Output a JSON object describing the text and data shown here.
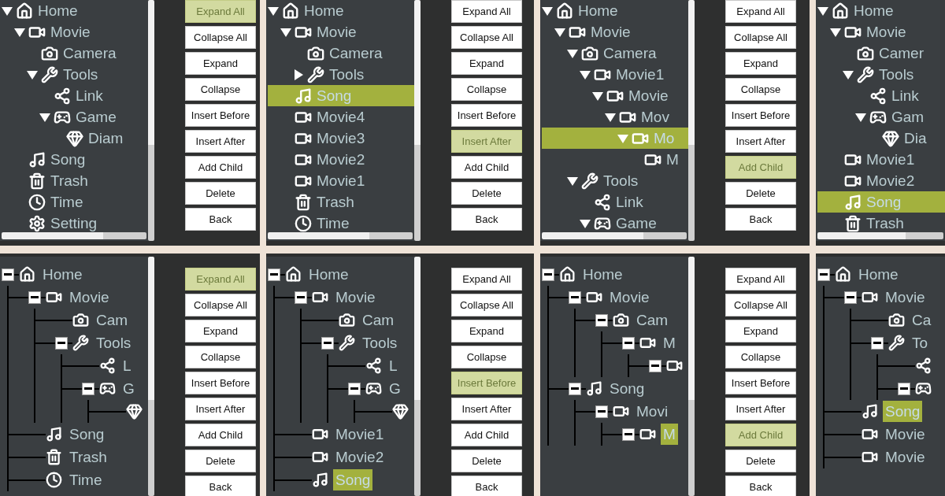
{
  "rows": [
    {
      "panels": [
        {
          "kind": "arrows",
          "tree": [
            {
              "label": "Home",
              "kind": "home",
              "expanded": true,
              "selected": false,
              "children": [
                {
                  "label": "Movie",
                  "kind": "movie",
                  "expanded": true,
                  "selected": false,
                  "children": [
                    {
                      "label": "Camera",
                      "kind": "camera",
                      "selected": false
                    },
                    {
                      "label": "Tools",
                      "kind": "tools",
                      "expanded": true,
                      "selected": false,
                      "children": [
                        {
                          "label": "Link",
                          "kind": "link",
                          "selected": false
                        },
                        {
                          "label": "Game",
                          "kind": "game",
                          "expanded": true,
                          "selected": false,
                          "children": [
                            {
                              "label": "Diam",
                              "kind": "diamond",
                              "selected": false
                            }
                          ]
                        }
                      ]
                    }
                  ]
                },
                {
                  "label": "Song",
                  "kind": "song",
                  "selected": false
                },
                {
                  "label": "Trash",
                  "kind": "trash",
                  "selected": false
                },
                {
                  "label": "Time",
                  "kind": "time",
                  "selected": false
                },
                {
                  "label": "Setting",
                  "kind": "setting",
                  "selected": false
                }
              ]
            }
          ],
          "buttons": [
            {
              "label": "Expand All",
              "selected": true
            },
            {
              "label": "Collapse All",
              "selected": false
            },
            {
              "label": "Expand",
              "selected": false
            },
            {
              "label": "Collapse",
              "selected": false
            },
            {
              "label": "Insert Before",
              "selected": false
            },
            {
              "label": "Insert After",
              "selected": false
            },
            {
              "label": "Add Child",
              "selected": false
            },
            {
              "label": "Delete",
              "selected": false
            },
            {
              "label": "Back",
              "selected": false
            }
          ]
        },
        {
          "kind": "arrows",
          "tree": [
            {
              "label": "Home",
              "kind": "home",
              "expanded": true,
              "selected": false,
              "children": [
                {
                  "label": "Movie",
                  "kind": "movie",
                  "expanded": true,
                  "selected": false,
                  "children": [
                    {
                      "label": "Camera",
                      "kind": "camera",
                      "selected": false
                    },
                    {
                      "label": "Tools",
                      "kind": "tools",
                      "expanded": false,
                      "selected": false
                    }
                  ]
                },
                {
                  "label": "Song",
                  "kind": "song",
                  "selected": true
                },
                {
                  "label": "Movie4",
                  "kind": "movie",
                  "selected": false
                },
                {
                  "label": "Movie3",
                  "kind": "movie",
                  "selected": false
                },
                {
                  "label": "Movie2",
                  "kind": "movie",
                  "selected": false
                },
                {
                  "label": "Movie1",
                  "kind": "movie",
                  "selected": false
                },
                {
                  "label": "Trash",
                  "kind": "trash",
                  "selected": false
                },
                {
                  "label": "Time",
                  "kind": "time",
                  "selected": false
                }
              ]
            }
          ],
          "buttons": [
            {
              "label": "Expand All",
              "selected": false
            },
            {
              "label": "Collapse All",
              "selected": false
            },
            {
              "label": "Expand",
              "selected": false
            },
            {
              "label": "Collapse",
              "selected": false
            },
            {
              "label": "Insert Before",
              "selected": false
            },
            {
              "label": "Insert After",
              "selected": true
            },
            {
              "label": "Add Child",
              "selected": false
            },
            {
              "label": "Delete",
              "selected": false
            },
            {
              "label": "Back",
              "selected": false
            }
          ]
        },
        {
          "kind": "arrows",
          "tree": [
            {
              "label": "Home",
              "kind": "home",
              "expanded": true,
              "selected": false,
              "children": [
                {
                  "label": "Movie",
                  "kind": "movie",
                  "expanded": true,
                  "selected": false,
                  "children": [
                    {
                      "label": "Camera",
                      "kind": "camera",
                      "expanded": true,
                      "selected": false,
                      "children": [
                        {
                          "label": "Movie1",
                          "kind": "movie",
                          "expanded": true,
                          "selected": false,
                          "children": [
                            {
                              "label": "Movie",
                              "kind": "movie",
                              "expanded": true,
                              "selected": false,
                              "children": [
                                {
                                  "label": "Mov",
                                  "kind": "movie",
                                  "expanded": true,
                                  "selected": false,
                                  "children": [
                                    {
                                      "label": "Mo",
                                      "kind": "movie",
                                      "expanded": true,
                                      "selected": true,
                                      "children": [
                                        {
                                          "label": "M",
                                          "kind": "movie",
                                          "selected": false
                                        }
                                      ]
                                    }
                                  ]
                                }
                              ]
                            }
                          ]
                        }
                      ]
                    },
                    {
                      "label": "Tools",
                      "kind": "tools",
                      "expanded": true,
                      "selected": false,
                      "children": [
                        {
                          "label": "Link",
                          "kind": "link",
                          "selected": false
                        },
                        {
                          "label": "Game",
                          "kind": "game",
                          "expanded": true,
                          "selected": false
                        }
                      ]
                    }
                  ]
                }
              ]
            }
          ],
          "buttons": [
            {
              "label": "Expand All",
              "selected": false
            },
            {
              "label": "Collapse All",
              "selected": false
            },
            {
              "label": "Expand",
              "selected": false
            },
            {
              "label": "Collapse",
              "selected": false
            },
            {
              "label": "Insert Before",
              "selected": false
            },
            {
              "label": "Insert After",
              "selected": false
            },
            {
              "label": "Add Child",
              "selected": true
            },
            {
              "label": "Delete",
              "selected": false
            },
            {
              "label": "Back",
              "selected": false
            }
          ]
        },
        {
          "kind": "arrows",
          "tree": [
            {
              "label": "Home",
              "kind": "home",
              "expanded": true,
              "selected": false,
              "children": [
                {
                  "label": "Movie",
                  "kind": "movie",
                  "expanded": true,
                  "selected": false,
                  "children": [
                    {
                      "label": "Camer",
                      "kind": "camera",
                      "selected": false
                    },
                    {
                      "label": "Tools",
                      "kind": "tools",
                      "expanded": true,
                      "selected": false,
                      "children": [
                        {
                          "label": "Link",
                          "kind": "link",
                          "selected": false
                        },
                        {
                          "label": "Gam",
                          "kind": "game",
                          "expanded": true,
                          "selected": false,
                          "children": [
                            {
                              "label": "Dia",
                              "kind": "diamond",
                              "selected": false
                            }
                          ]
                        }
                      ]
                    }
                  ]
                },
                {
                  "label": "Movie1",
                  "kind": "movie",
                  "selected": false
                },
                {
                  "label": "Movie2",
                  "kind": "movie",
                  "selected": false
                },
                {
                  "label": "Song",
                  "kind": "song",
                  "selected": true
                },
                {
                  "label": "Trash",
                  "kind": "trash",
                  "selected": false
                }
              ]
            }
          ]
        }
      ]
    },
    {
      "panels": [
        {
          "kind": "boxes",
          "tree": [
            {
              "label": "Home",
              "kind": "home",
              "expanded": true,
              "selected": false,
              "children": [
                {
                  "label": "Movie",
                  "kind": "movie",
                  "expanded": true,
                  "selected": false,
                  "children": [
                    {
                      "label": "Cam",
                      "kind": "camera",
                      "selected": false
                    },
                    {
                      "label": "Tools",
                      "kind": "tools",
                      "expanded": true,
                      "selected": false,
                      "children": [
                        {
                          "label": "L",
                          "kind": "link",
                          "selected": false
                        },
                        {
                          "label": "G",
                          "kind": "game",
                          "expanded": true,
                          "selected": false,
                          "children": [
                            {
                              "kind": "diamond",
                              "selected": false
                            }
                          ]
                        }
                      ]
                    }
                  ]
                },
                {
                  "label": "Song",
                  "kind": "song",
                  "selected": false
                },
                {
                  "label": "Trash",
                  "kind": "trash",
                  "selected": false
                },
                {
                  "label": "Time",
                  "kind": "time",
                  "selected": false
                }
              ]
            }
          ],
          "buttons": [
            {
              "label": "Expand All",
              "selected": true
            },
            {
              "label": "Collapse All",
              "selected": false
            },
            {
              "label": "Expand",
              "selected": false
            },
            {
              "label": "Collapse",
              "selected": false
            },
            {
              "label": "Insert Before",
              "selected": false
            },
            {
              "label": "Insert After",
              "selected": false
            },
            {
              "label": "Add Child",
              "selected": false
            },
            {
              "label": "Delete",
              "selected": false
            },
            {
              "label": "Back",
              "selected": false
            }
          ]
        },
        {
          "kind": "boxes",
          "tree": [
            {
              "label": "Home",
              "kind": "home",
              "expanded": true,
              "selected": false,
              "children": [
                {
                  "label": "Movie",
                  "kind": "movie",
                  "expanded": true,
                  "selected": false,
                  "children": [
                    {
                      "label": "Cam",
                      "kind": "camera",
                      "selected": false
                    },
                    {
                      "label": "Tools",
                      "kind": "tools",
                      "expanded": true,
                      "selected": false,
                      "children": [
                        {
                          "label": "L",
                          "kind": "link",
                          "selected": false
                        },
                        {
                          "label": "G",
                          "kind": "game",
                          "expanded": true,
                          "selected": false,
                          "children": [
                            {
                              "kind": "diamond",
                              "selected": false
                            }
                          ]
                        }
                      ]
                    }
                  ]
                },
                {
                  "label": "Movie1",
                  "kind": "movie",
                  "selected": false
                },
                {
                  "label": "Movie2",
                  "kind": "movie",
                  "selected": false
                },
                {
                  "label": "Song",
                  "kind": "song",
                  "selected": true
                }
              ]
            }
          ],
          "buttons": [
            {
              "label": "Expand All",
              "selected": false
            },
            {
              "label": "Collapse All",
              "selected": false
            },
            {
              "label": "Expand",
              "selected": false
            },
            {
              "label": "Collapse",
              "selected": false
            },
            {
              "label": "Insert Before",
              "selected": true
            },
            {
              "label": "Insert After",
              "selected": false
            },
            {
              "label": "Add Child",
              "selected": false
            },
            {
              "label": "Delete",
              "selected": false
            },
            {
              "label": "Back",
              "selected": false
            }
          ]
        },
        {
          "kind": "boxes",
          "tree": [
            {
              "label": "Home",
              "kind": "home",
              "expanded": true,
              "selected": false,
              "children": [
                {
                  "label": "Movie",
                  "kind": "movie",
                  "expanded": true,
                  "selected": false,
                  "children": [
                    {
                      "label": "Cam",
                      "kind": "camera",
                      "expanded": true,
                      "selected": false,
                      "children": [
                        {
                          "label": "M",
                          "kind": "movie",
                          "expanded": true,
                          "selected": false,
                          "children": [
                            {
                              "kind": "movie",
                              "expanded": true,
                              "selected": false
                            }
                          ]
                        }
                      ]
                    }
                  ]
                },
                {
                  "label": "Song",
                  "kind": "song",
                  "expanded": true,
                  "selected": false,
                  "children": [
                    {
                      "label": "Movi",
                      "kind": "movie",
                      "expanded": true,
                      "selected": false,
                      "children": [
                        {
                          "label": "M",
                          "kind": "movie",
                          "expanded": true,
                          "selected": true
                        }
                      ]
                    }
                  ]
                }
              ]
            }
          ],
          "buttons": [
            {
              "label": "Expand All",
              "selected": false
            },
            {
              "label": "Collapse All",
              "selected": false
            },
            {
              "label": "Expand",
              "selected": false
            },
            {
              "label": "Collapse",
              "selected": false
            },
            {
              "label": "Insert Before",
              "selected": false
            },
            {
              "label": "Insert After",
              "selected": false
            },
            {
              "label": "Add Child",
              "selected": true
            },
            {
              "label": "Delete",
              "selected": false
            },
            {
              "label": "Back",
              "selected": false
            }
          ]
        },
        {
          "kind": "boxes",
          "tree": [
            {
              "label": "Home",
              "kind": "home",
              "expanded": true,
              "selected": false,
              "children": [
                {
                  "label": "Movie",
                  "kind": "movie",
                  "expanded": true,
                  "selected": false,
                  "children": [
                    {
                      "label": "Ca",
                      "kind": "camera",
                      "selected": false
                    },
                    {
                      "label": "To",
                      "kind": "tools",
                      "expanded": true,
                      "selected": false,
                      "children": [
                        {
                          "kind": "link",
                          "selected": false
                        },
                        {
                          "kind": "game",
                          "expanded": true,
                          "selected": false
                        }
                      ]
                    }
                  ]
                },
                {
                  "label": "Song",
                  "kind": "song",
                  "selected": true
                },
                {
                  "label": "Movie",
                  "kind": "movie",
                  "selected": false
                },
                {
                  "label": "Movie",
                  "kind": "movie",
                  "selected": false
                }
              ]
            }
          ]
        }
      ]
    }
  ]
}
